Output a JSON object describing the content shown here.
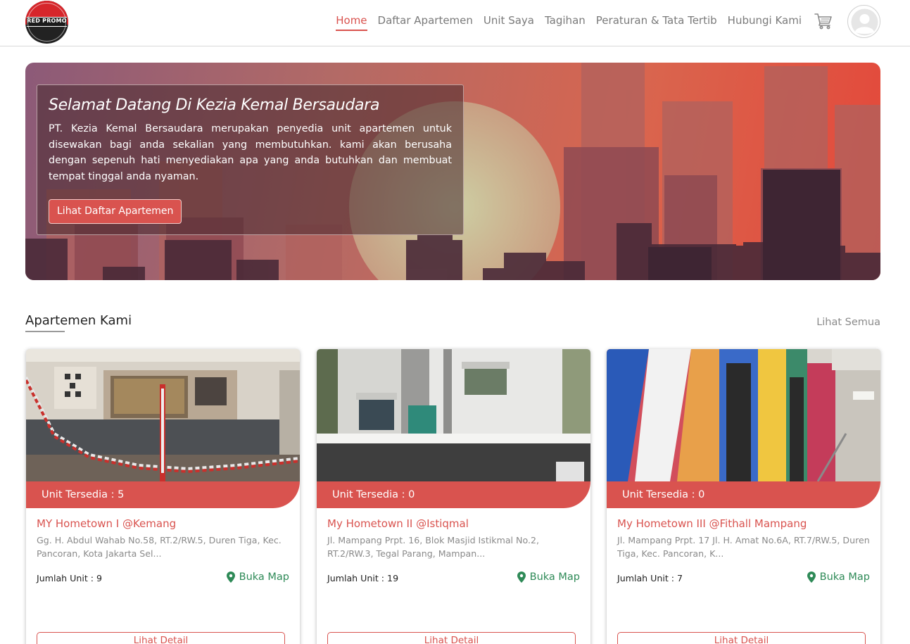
{
  "brand": {
    "logo_text": "RED PROMO",
    "accent_color": "#d9534f",
    "map_color": "#2e8a57"
  },
  "nav": {
    "items": [
      {
        "label": "Home",
        "active": true
      },
      {
        "label": "Daftar Apartemen",
        "active": false
      },
      {
        "label": "Unit Saya",
        "active": false
      },
      {
        "label": "Tagihan",
        "active": false
      },
      {
        "label": "Peraturan & Tata Tertib",
        "active": false
      },
      {
        "label": "Hubungi Kami",
        "active": false
      }
    ],
    "cart_icon": "cart-icon",
    "avatar_icon": "user-avatar-icon"
  },
  "hero": {
    "title": "Selamat Datang Di Kezia Kemal Bersaudara",
    "description": "PT. Kezia Kemal Bersaudara merupakan penyedia unit apartemen untuk disewakan bagi anda sekalian yang membutuhkan. kami akan berusaha dengan sepenuh hati menyediakan apa yang anda butuhkan dan membuat tempat tinggal anda nyaman.",
    "button_label": "Lihat Daftar Apartemen"
  },
  "section": {
    "title": "Apartemen Kami",
    "see_all": "Lihat Semua"
  },
  "cards": [
    {
      "badge": "Unit Tersedia : 5",
      "name": "MY Hometown I @Kemang",
      "address": "Gg. H. Abdul Wahab No.58, RT.2/RW.5, Duren Tiga, Kec. Pancoran, Kota Jakarta Sel...",
      "units": "Jumlah Unit : 9",
      "map_label": "Buka Map",
      "detail_label": "Lihat Detail"
    },
    {
      "badge": "Unit Tersedia : 0",
      "name": "My Hometown II @Istiqmal",
      "address": "Jl. Mampang Prpt. 16, Blok Masjid Istikmal No.2, RT.2/RW.3, Tegal Parang, Mampan...",
      "units": "Jumlah Unit : 19",
      "map_label": "Buka Map",
      "detail_label": "Lihat Detail"
    },
    {
      "badge": "Unit Tersedia : 0",
      "name": "My Hometown III @Fithall Mampang",
      "address": "Jl. Mampang Prpt. 17 Jl. H. Amat No.6A, RT.7/RW.5, Duren Tiga, Kec. Pancoran, K...",
      "units": "Jumlah Unit : 7",
      "map_label": "Buka Map",
      "detail_label": "Lihat Detail"
    }
  ]
}
